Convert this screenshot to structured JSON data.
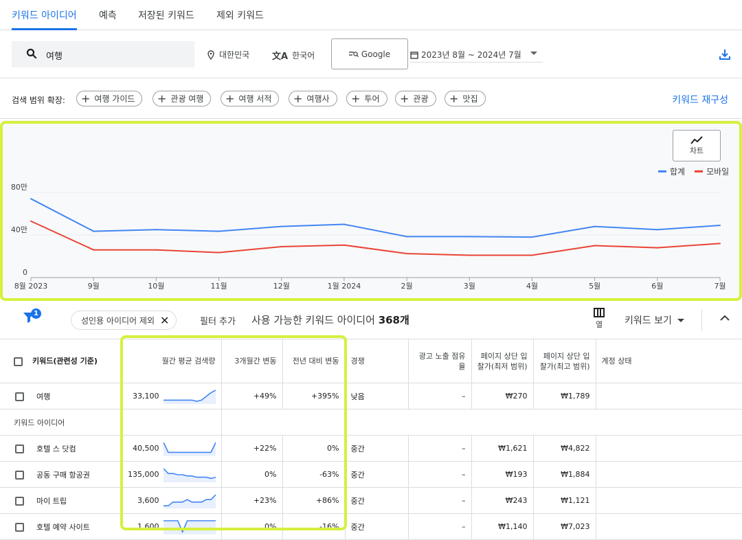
{
  "tabs": [
    {
      "label": "키워드 아이디어"
    },
    {
      "label": "예측"
    },
    {
      "label": "저장된 키워드"
    },
    {
      "label": "제외 키워드"
    }
  ],
  "toolbar": {
    "query": "여행",
    "location": "대한민국",
    "language": "한국어",
    "engine": "Google",
    "date_range": "2023년 8월 ~ 2024년 7월"
  },
  "expand": {
    "label": "검색 범위 확장:",
    "chips": [
      "여행 가이드",
      "관광 여행",
      "여행 서적",
      "여행사",
      "투어",
      "관광",
      "맛집"
    ],
    "refine": "키워드 재구성"
  },
  "chart_data": {
    "type": "line",
    "categories": [
      "8월 2023",
      "9월",
      "10월",
      "11월",
      "12월",
      "1월 2024",
      "2월",
      "3월",
      "4월",
      "5월",
      "6월",
      "7월"
    ],
    "series": [
      {
        "name": "합계",
        "color": "#4285f4",
        "values": [
          74000,
          43500,
          45000,
          43500,
          48000,
          50000,
          38500,
          38500,
          38000,
          48000,
          45000,
          49000
        ]
      },
      {
        "name": "모바일",
        "color": "#ea4335",
        "values": [
          53000,
          26000,
          26000,
          23500,
          29000,
          30500,
          22500,
          21000,
          21000,
          30000,
          28000,
          32000
        ]
      }
    ],
    "yticks": [
      "0",
      "40만",
      "80만"
    ],
    "ylim": [
      0,
      80000
    ],
    "button_label": "차트"
  },
  "filterbar": {
    "badge": "1",
    "chip": "성인용 아이디어 제외",
    "add_filter": "필터 추가",
    "available_prefix": "사용 가능한 키워드 아이디어",
    "available_count": "368개",
    "columns": "열",
    "keyword_view": "키워드 보기"
  },
  "table": {
    "headers": [
      "키워드(관련성 기준)",
      "월간 평균 검색량",
      "3개월간 변동",
      "전년 대비 변동",
      "경쟁",
      "광고 노출 점유율",
      "페이지 상단 입찰가(최저 범위)",
      "페이지 상단 입찰가(최고 범위)",
      "계정 상태"
    ],
    "main_row": {
      "keyword": "여행",
      "volume": "33,100",
      "three_month": "+49%",
      "yoy": "+395%",
      "competition": "낮음",
      "share": "–",
      "low_bid": "₩270",
      "high_bid": "₩1,789",
      "spark": [
        2,
        2,
        2,
        2,
        2,
        2,
        2,
        1,
        2,
        5,
        8,
        10
      ]
    },
    "section_label": "키워드 아이디어",
    "rows": [
      {
        "keyword": "호텔 스 닷컴",
        "volume": "40,500",
        "three_month": "+22%",
        "yoy": "0%",
        "competition": "중간",
        "share": "–",
        "low_bid": "₩1,621",
        "high_bid": "₩4,822",
        "spark": [
          10,
          2,
          2,
          2,
          2,
          2,
          2,
          2,
          2,
          2,
          2,
          10
        ]
      },
      {
        "keyword": "공동 구매 항공권",
        "volume": "135,000",
        "three_month": "0%",
        "yoy": "-63%",
        "competition": "중간",
        "share": "–",
        "low_bid": "₩193",
        "high_bid": "₩1,884",
        "spark": [
          10,
          6,
          6,
          5,
          5,
          4,
          4,
          3,
          3,
          3,
          2,
          3
        ]
      },
      {
        "keyword": "마이 트립",
        "volume": "3,600",
        "three_month": "+23%",
        "yoy": "+86%",
        "competition": "중간",
        "share": "–",
        "low_bid": "₩243",
        "high_bid": "₩1,121",
        "spark": [
          1,
          1,
          4,
          4,
          4,
          6,
          4,
          4,
          4,
          6,
          6,
          10
        ]
      },
      {
        "keyword": "호텔 예약 사이트",
        "volume": "1,600",
        "three_month": "0%",
        "yoy": "-16%",
        "competition": "중간",
        "share": "–",
        "low_bid": "₩1,140",
        "high_bid": "₩7,023",
        "spark": [
          10,
          10,
          10,
          10,
          1,
          10,
          10,
          10,
          10,
          10,
          10,
          10
        ]
      }
    ]
  }
}
